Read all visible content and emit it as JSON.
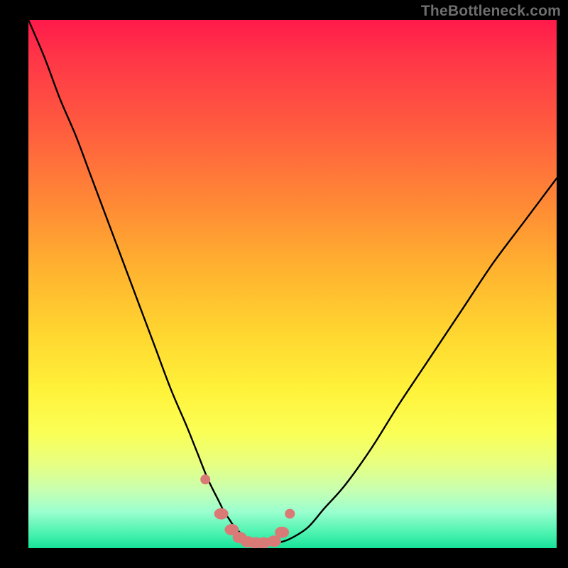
{
  "watermark": "TheBottleneck.com",
  "colors": {
    "frame": "#000000",
    "curve": "#000000",
    "marker": "#d97a77",
    "gradient_top": "#ff1a4a",
    "gradient_bottom": "#17e39a"
  },
  "chart_data": {
    "type": "line",
    "title": "",
    "xlabel": "",
    "ylabel": "",
    "xlim": [
      0,
      100
    ],
    "ylim": [
      0,
      100
    ],
    "x": [
      0,
      3,
      6,
      9,
      12,
      15,
      18,
      21,
      24,
      27,
      30,
      32,
      34,
      36,
      37,
      38,
      39,
      40,
      41,
      42,
      43,
      44,
      46,
      48,
      50,
      53,
      56,
      60,
      65,
      70,
      76,
      82,
      88,
      94,
      100
    ],
    "values": [
      100,
      93,
      85,
      78,
      70,
      62,
      54,
      46,
      38,
      30,
      23,
      18,
      13,
      9,
      7,
      5.5,
      4,
      3,
      2.2,
      1.6,
      1.2,
      1,
      1,
      1.2,
      2,
      4,
      7.5,
      12,
      19,
      27,
      36,
      45,
      54,
      62,
      70
    ],
    "markers": {
      "x": [
        33.5,
        36.5,
        38.5,
        40,
        41.5,
        43,
        44.5,
        46.5,
        48,
        49.5
      ],
      "y": [
        13,
        6.5,
        3.5,
        2,
        1.2,
        1,
        1,
        1.3,
        3,
        6.5
      ]
    }
  }
}
